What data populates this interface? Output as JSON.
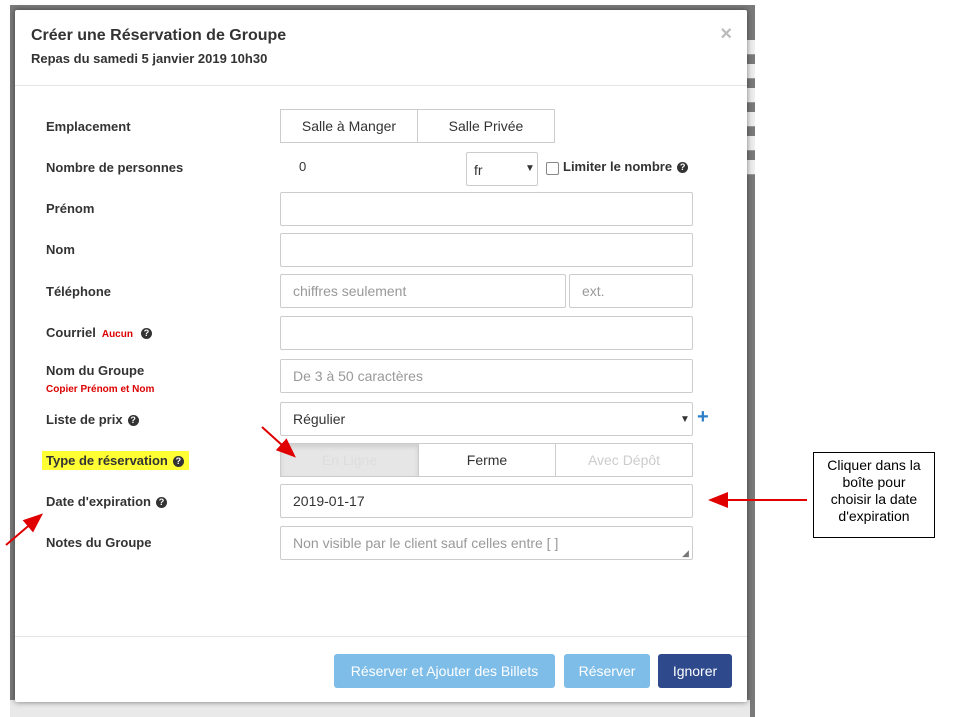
{
  "modal": {
    "title": "Créer une Réservation de Groupe",
    "subtitle": "Repas du samedi 5 janvier 2019 10h30",
    "close": "×"
  },
  "form": {
    "emplacement": {
      "label": "Emplacement",
      "options": [
        "Salle à Manger",
        "Salle Privée"
      ]
    },
    "nombre": {
      "label": "Nombre de personnes",
      "value": "0",
      "lang": "fr",
      "limit_label": "Limiter le nombre"
    },
    "prenom": {
      "label": "Prénom",
      "value": ""
    },
    "nom": {
      "label": "Nom",
      "value": ""
    },
    "telephone": {
      "label": "Téléphone",
      "placeholder": "chiffres seulement",
      "ext_placeholder": "ext."
    },
    "courriel": {
      "label": "Courriel",
      "badge": "Aucun",
      "value": ""
    },
    "groupe": {
      "label": "Nom du Groupe",
      "sublink": "Copier Prénom et Nom",
      "placeholder": "De 3 à 50 caractères"
    },
    "prix": {
      "label": "Liste de prix",
      "value": "Régulier"
    },
    "type": {
      "label": "Type de réservation",
      "options": [
        "En Ligne",
        "Ferme",
        "Avec Dépôt"
      ],
      "active": "En Ligne"
    },
    "expiration": {
      "label": "Date d'expiration",
      "value": "2019-01-17"
    },
    "notes": {
      "label": "Notes du Groupe",
      "placeholder": "Non visible par le client sauf celles entre [ ]"
    }
  },
  "footer": {
    "reserve_add": "Réserver et Ajouter des Billets",
    "reserve": "Réserver",
    "ignore": "Ignorer"
  },
  "annotation": {
    "line1": "Cliquer dans la",
    "line2": "boîte pour",
    "line3": "choisir la date",
    "line4": "d'expiration"
  },
  "colors": {
    "highlight": "#ffff33",
    "arrow": "#e00000",
    "primary_light": "#7ebde8",
    "primary_dark": "#2e4a8c",
    "required_red": "#d00000"
  }
}
